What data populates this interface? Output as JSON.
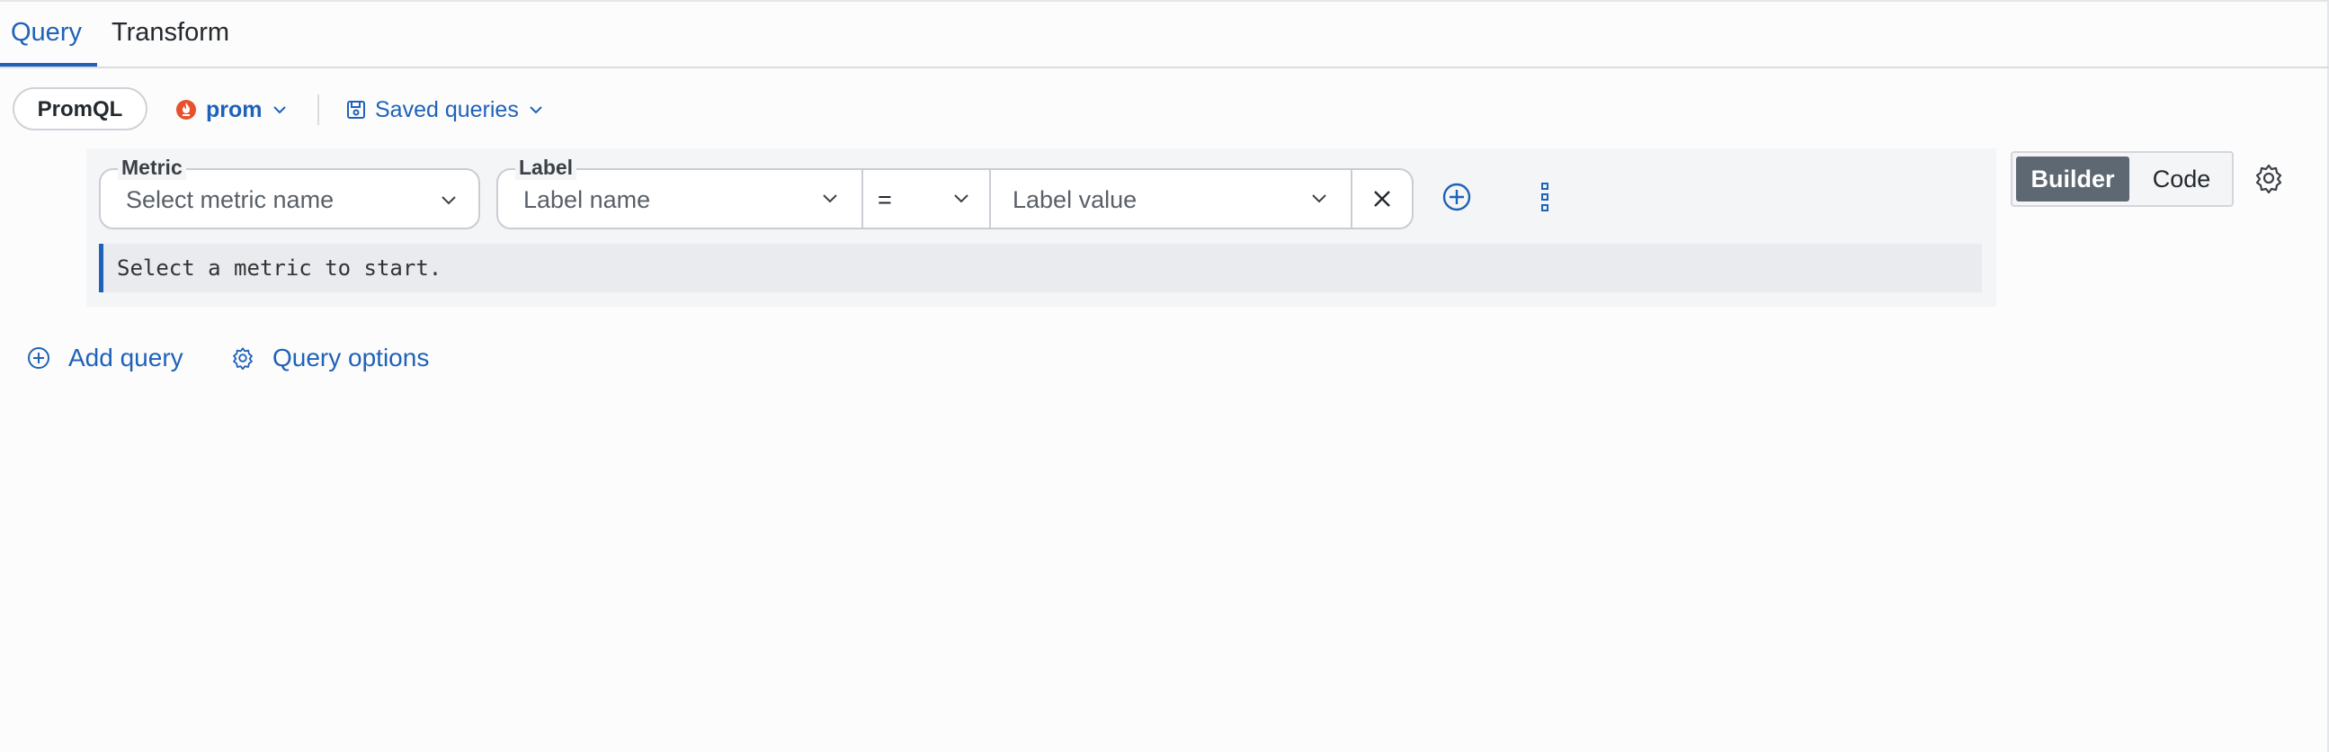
{
  "tabs": [
    {
      "label": "Query",
      "active": true
    },
    {
      "label": "Transform",
      "active": false
    }
  ],
  "toolbar": {
    "language_button": "PromQL",
    "datasource": {
      "name": "prom",
      "icon": "prometheus-flame-icon",
      "color": "#e6522c"
    },
    "saved_queries": "Saved queries"
  },
  "editor": {
    "metric": {
      "legend": "Metric",
      "placeholder": "Select metric name"
    },
    "label": {
      "legend": "Label",
      "name_placeholder": "Label name",
      "operator": "=",
      "value_placeholder": "Label value"
    },
    "hint": "Select a metric to start."
  },
  "mode": {
    "builder": "Builder",
    "code": "Code",
    "selected": "Builder"
  },
  "actions": {
    "add_query": "Add query",
    "query_options": "Query options"
  },
  "colors": {
    "accent": "#1f62b8",
    "active_toggle": "#5e6873",
    "datasource_icon": "#e6522c"
  }
}
